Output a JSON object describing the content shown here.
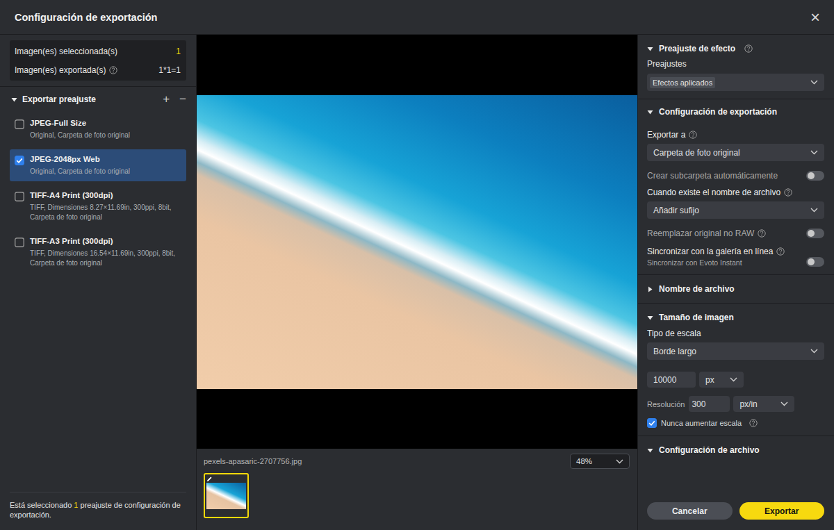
{
  "window": {
    "title": "Configuración de exportación",
    "close": "×"
  },
  "summary": [
    {
      "label": "Imagen(es) seleccionada(s)",
      "value": "1",
      "help": false,
      "highlight": true
    },
    {
      "label": "Imagen(es) exportada(s)",
      "value": "1*1=1",
      "help": true,
      "highlight": false
    }
  ],
  "presets": {
    "title": "Exportar preajuste",
    "expanded": true,
    "add": "+",
    "remove": "−",
    "items": [
      {
        "name": "JPEG-Full Size",
        "detail": "Original, Carpeta de foto original",
        "checked": false,
        "selected": false
      },
      {
        "name": "JPEG-2048px Web",
        "detail": "Original, Carpeta de foto original",
        "checked": true,
        "selected": true
      },
      {
        "name": "TIFF-A4 Print (300dpi)",
        "detail": "TIFF, Dimensiones 8.27×11.69in, 300ppi, 8bit, Carpeta de foto original",
        "checked": false,
        "selected": false
      },
      {
        "name": "TIFF-A3 Print (300dpi)",
        "detail": "TIFF, Dimensiones 16.54×11.69in, 300ppi, 8bit, Carpeta de foto original",
        "checked": false,
        "selected": false
      }
    ]
  },
  "selection_note": {
    "before": "Está seleccionado ",
    "count": "1",
    "after": " preajuste de configuración de exportación."
  },
  "preview": {
    "filename": "pexels-apasaric-2707756.jpg",
    "zoom": "48%",
    "thumbnails": [
      {
        "selected": true,
        "edited": true
      }
    ]
  },
  "effect_preset": {
    "title": "Preajuste de efecto",
    "expanded": true,
    "help": true,
    "label": "Preajustes",
    "tag": "Efectos aplicados"
  },
  "export_settings": {
    "title": "Configuración de exportación",
    "expanded": true,
    "rows": [
      {
        "kind": "select",
        "label": "Exportar a",
        "help": true,
        "value": "Carpeta de foto original"
      },
      {
        "kind": "toggle",
        "label": "Crear subcarpeta automáticamente",
        "help": false,
        "on": false,
        "sublabel": ""
      },
      {
        "kind": "select",
        "label": "Cuando existe el nombre de archivo",
        "help": true,
        "value": "Añadir sufijo"
      },
      {
        "kind": "toggle",
        "label": "Reemplazar original no RAW",
        "help": true,
        "on": false,
        "sublabel": ""
      },
      {
        "kind": "toggle",
        "label": "Sincronizar con la galería en línea",
        "help": true,
        "on": false,
        "sublabel": "Sincronizar con Evoto Instant"
      }
    ]
  },
  "file_name": {
    "title": "Nombre de archivo",
    "expanded": false
  },
  "image_size": {
    "title": "Tamaño de imagen",
    "expanded": true,
    "scale_label": "Tipo de escala",
    "scale_type": "Borde largo",
    "size": "10000",
    "size_unit": "px",
    "resolution_label": "Resolución",
    "resolution": "300",
    "resolution_unit": "px/in",
    "never_upscale": {
      "label": "Nunca aumentar escala",
      "checked": true,
      "help": true
    }
  },
  "file_settings": {
    "title": "Configuración de archivo",
    "expanded": true
  },
  "buttons": [
    {
      "label": "Cancelar",
      "primary": false
    },
    {
      "label": "Exportar",
      "primary": true
    }
  ]
}
